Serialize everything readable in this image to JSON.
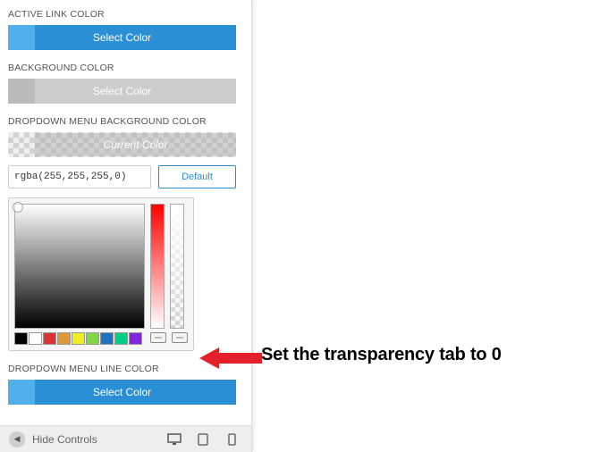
{
  "labels": {
    "active_link_color": "ACTIVE LINK COLOR",
    "background_color": "BACKGROUND COLOR",
    "dd_bg_color": "DROPDOWN MENU BACKGROUND COLOR",
    "dd_line_color": "DROPDOWN MENU LINE COLOR"
  },
  "buttons": {
    "select_color": "Select Color",
    "current_color": "Current Color",
    "default": "Default"
  },
  "values": {
    "rgba": "rgba(255,255,255,0)"
  },
  "palette": [
    "#000000",
    "#ffffff",
    "#dd3333",
    "#dd9933",
    "#eeee22",
    "#81d742",
    "#1e73be",
    "#00d084",
    "#8224e3"
  ],
  "footer": {
    "hide_controls": "Hide Controls"
  },
  "annotation": "Set the transparency tab to 0"
}
